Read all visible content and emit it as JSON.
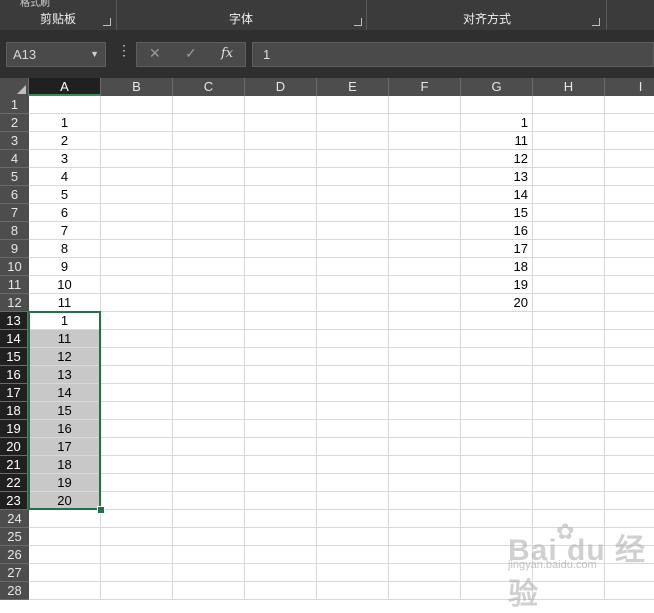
{
  "ribbon": {
    "cut_label": "格式刷",
    "groups": [
      {
        "label": "剪贴板"
      },
      {
        "label": "字体"
      },
      {
        "label": "对齐方式"
      }
    ]
  },
  "formula_bar": {
    "name_box": "A13",
    "cancel_glyph": "✕",
    "enter_glyph": "✓",
    "fx_label": "fx",
    "content": "1"
  },
  "sheet": {
    "columns": [
      "A",
      "B",
      "C",
      "D",
      "E",
      "F",
      "G",
      "H",
      "I"
    ],
    "rows": [
      "1",
      "2",
      "3",
      "4",
      "5",
      "6",
      "7",
      "8",
      "9",
      "10",
      "11",
      "12",
      "13",
      "14",
      "15",
      "16",
      "17",
      "18",
      "19",
      "20",
      "21",
      "22",
      "23",
      "24",
      "25",
      "26",
      "27",
      "28"
    ],
    "column_a": [
      "",
      "1",
      "2",
      "3",
      "4",
      "5",
      "6",
      "7",
      "8",
      "9",
      "10",
      "11",
      "1",
      "11",
      "12",
      "13",
      "14",
      "15",
      "16",
      "17",
      "18",
      "19",
      "20",
      "",
      "",
      "",
      "",
      ""
    ],
    "column_g": [
      "",
      "1",
      "11",
      "12",
      "13",
      "14",
      "15",
      "16",
      "17",
      "18",
      "19",
      "20",
      "",
      "",
      "",
      "",
      "",
      "",
      "",
      "",
      "",
      "",
      "",
      "",
      "",
      "",
      "",
      ""
    ],
    "active_cell": "A13",
    "selection": "A13:A23"
  },
  "watermark": {
    "brand": "Bai du 经验",
    "url": "jingyan.baidu.com"
  },
  "colors": {
    "ribbon_bg": "#3b3b3b",
    "header_bg": "#4d4d4d",
    "selection_border": "#217346",
    "selected_fill": "#c8c8c8"
  }
}
